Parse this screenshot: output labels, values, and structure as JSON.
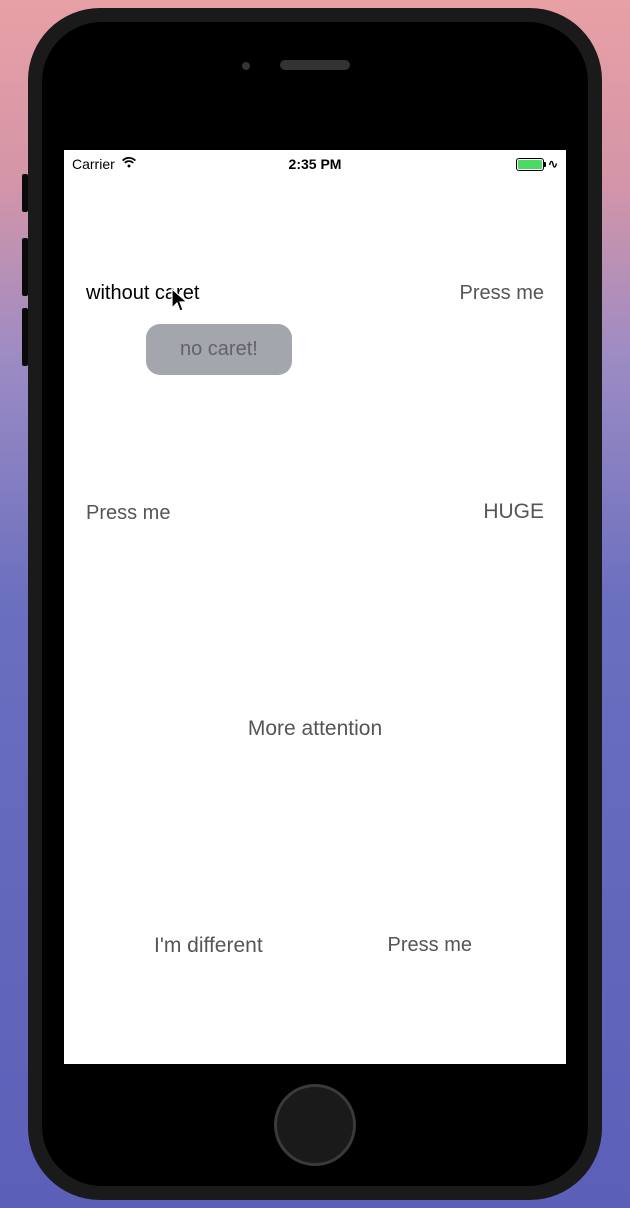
{
  "statusBar": {
    "carrier": "Carrier",
    "time": "2:35 PM"
  },
  "buttons": {
    "withoutCaret": "without caret",
    "pressMeTopRight": "Press me",
    "pressMeMidLeft": "Press me",
    "huge": "HUGE",
    "moreAttention": "More attention",
    "imDifferent": "I'm different",
    "pressMeBottom": "Press me"
  },
  "tooltip": {
    "noCaret": "no caret!"
  }
}
